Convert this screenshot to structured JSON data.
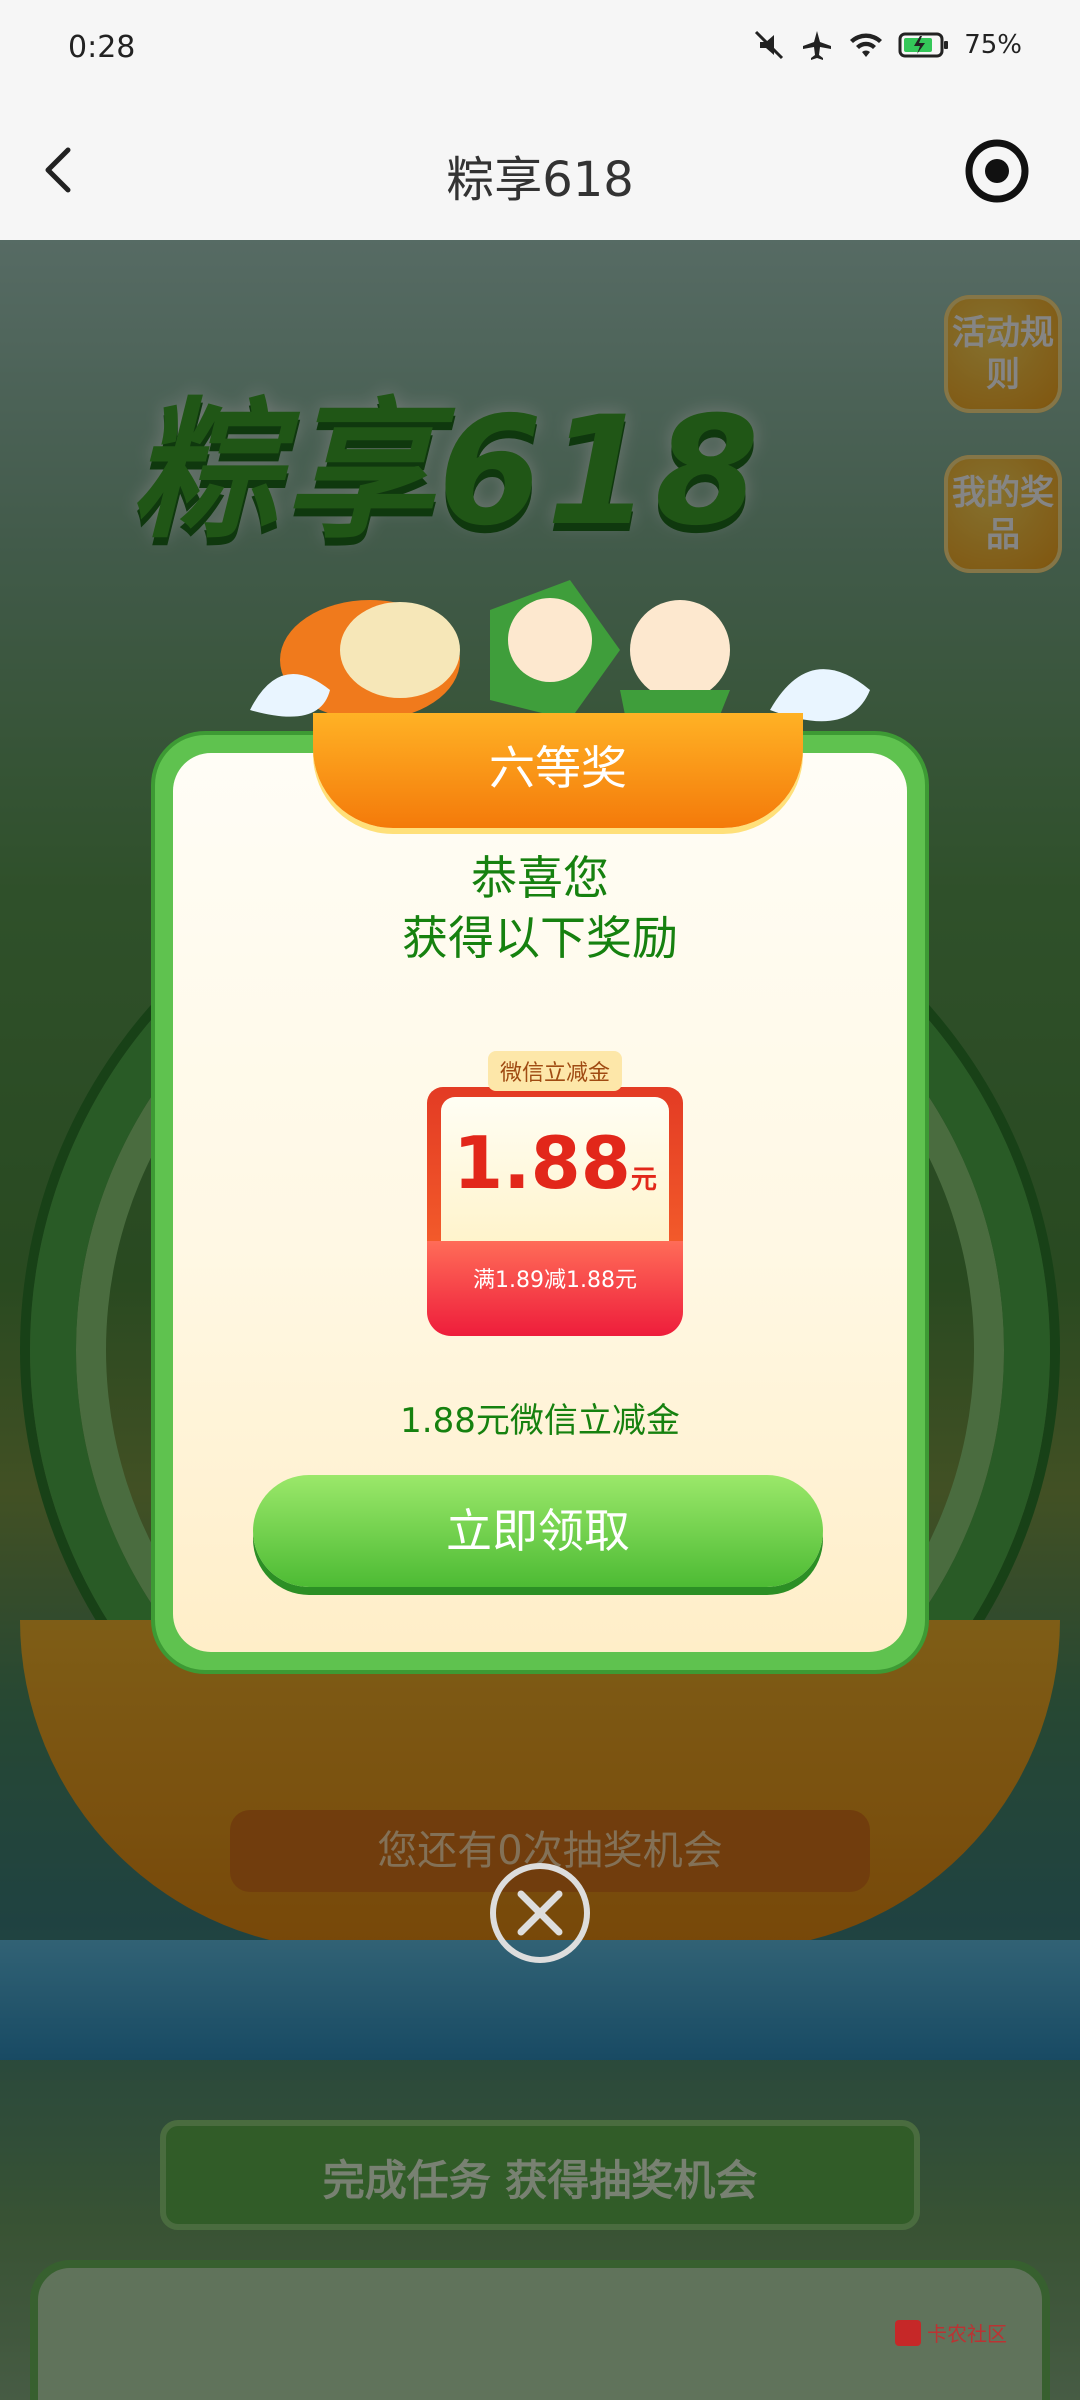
{
  "status_bar": {
    "time": "0:28",
    "battery": "75%"
  },
  "nav": {
    "title": "粽享618"
  },
  "background": {
    "headline": "粽享618",
    "side_buttons": [
      {
        "label": "活动规则"
      },
      {
        "label": "我的奖品"
      }
    ],
    "chance_text": "您还有0次抽奖机会",
    "task_title": "完成任务  获得抽奖机会"
  },
  "modal": {
    "ribbon": "六等奖",
    "congrats_line1": "恭喜您",
    "congrats_line2": "获得以下奖励",
    "coupon": {
      "tag": "微信立减金",
      "amount": "1.88",
      "unit": "元",
      "condition": "满1.89减1.88元"
    },
    "prize_desc": "1.88元微信立减金",
    "claim_label": "立即领取"
  },
  "watermark": "卡农社区",
  "colors": {
    "accent_green": "#5fc24f",
    "orange": "#f47a0a",
    "red": "#e2271a"
  }
}
